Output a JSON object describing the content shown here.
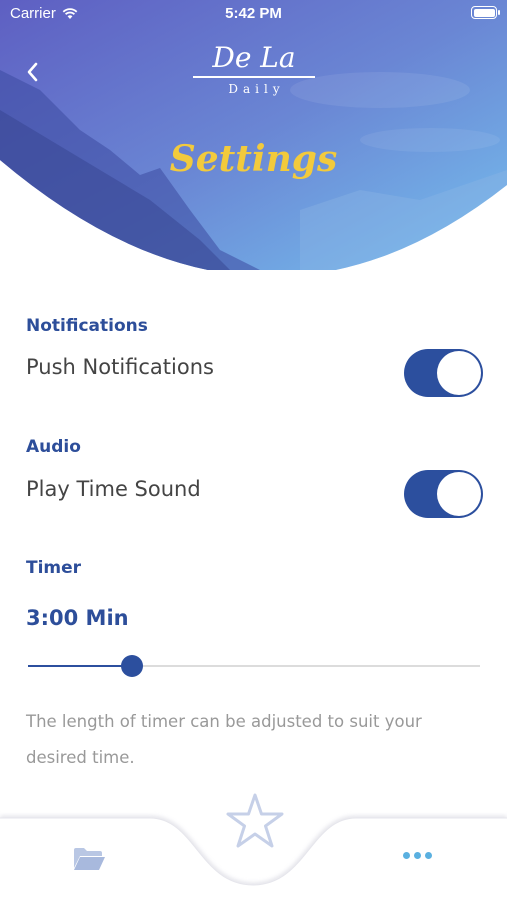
{
  "status_bar": {
    "carrier": "Carrier",
    "time": "5:42 PM"
  },
  "header": {
    "logo_title": "De La",
    "logo_subtitle": "Daily",
    "page_title": "Settings",
    "colors": {
      "gradient_top": "#6a72c9",
      "gradient_bottom": "#6fb2e8",
      "title": "#f2ca3c"
    }
  },
  "notifications": {
    "section_label": "Notifications",
    "row_label": "Push Notifications",
    "enabled": true
  },
  "audio": {
    "section_label": "Audio",
    "row_label": "Play Time Sound",
    "enabled": true
  },
  "timer": {
    "section_label": "Timer",
    "value_label": "3:00 Min",
    "slider_fraction": 0.23,
    "description": "The length of timer can be adjusted to suit your desired time."
  },
  "tab_bar": {
    "items": [
      "folder-icon",
      "star-icon",
      "more-icon"
    ],
    "accent": "#2c4f9e"
  }
}
